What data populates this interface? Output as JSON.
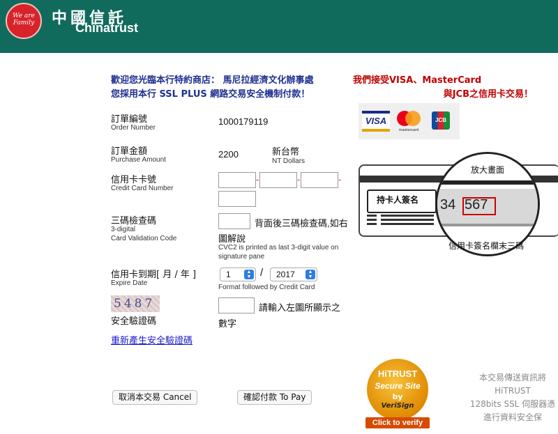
{
  "header": {
    "logo_text": "We are Family",
    "brand_cn": "中國信託",
    "brand_en": "Chinatrust",
    "background": "#116b5d"
  },
  "welcome": {
    "line1": "歡迎您光臨本行特約商店： 馬尼拉經濟文化辦事處",
    "line2": "您採用本行 SSL PLUS 網路交易安全機制付款！"
  },
  "accept": {
    "line1": "我們接受VISA、MasterCard",
    "line2": "與JCB之信用卡交易！"
  },
  "card_logos": {
    "visa": "VISA",
    "mastercard": "mastercard",
    "jcb": "JCB"
  },
  "order": {
    "label_cn": "訂單編號",
    "label_en": "Order Number",
    "value": "1000179119"
  },
  "amount": {
    "label_cn": "訂單金額",
    "label_en": "Purchase Amount",
    "value": "2200",
    "currency_cn": "新台幣",
    "currency_en": "NT Dollars"
  },
  "card_number": {
    "label_cn": "信用卡卡號",
    "label_en": "Credit Card Number"
  },
  "cvc": {
    "label_cn": "三碼檢查碼",
    "label_en1": "3-digital",
    "label_en2": "Card Validation Code",
    "hint1": "背面後三碼檢查碼,如右",
    "hint2": "圖解說",
    "hint_en1": "CVC2 is printed as last 3-digit value on",
    "hint_en2": "signature pane"
  },
  "expiry": {
    "label_cn": "信用卡到期[ 月 / 年 ]",
    "label_en": "Expire Date",
    "month": "1",
    "separator": "/",
    "year": "2017",
    "note": "Format followed by Credit Card"
  },
  "captcha": {
    "image_text": "5487",
    "label_cn": "安全驗證碼",
    "prompt1": "請輸入左圖所顯示之",
    "prompt2": "數字",
    "regenerate_link": "重新產生安全驗證碼"
  },
  "illustration": {
    "signature_label": "持卡人簽名",
    "magnify_label": "放大畫面",
    "digits_prefix": "34",
    "digits": "567",
    "caption": "信用卡簽名欄末三碼"
  },
  "buttons": {
    "cancel": "取消本交易 Cancel",
    "pay": "確認付款 To Pay"
  },
  "hitrust": {
    "line1": "HiTRUST",
    "line2": "Secure Site",
    "line3": "by",
    "line4": "VeriSign",
    "click": "Click to verify"
  },
  "ssl_note": {
    "line1": "本交易傳送資訊將",
    "line2": "HiTRUST",
    "line3": "128bits SSL 伺服器憑",
    "line4": "進行資料安全保"
  }
}
